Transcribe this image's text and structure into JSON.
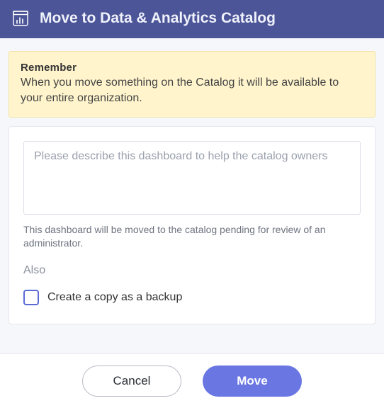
{
  "header": {
    "title": "Move to Data & Analytics Catalog"
  },
  "remember": {
    "title": "Remember",
    "text": "When you move something on the Catalog it will be available to your entire organization."
  },
  "form": {
    "description_placeholder": "Please describe this dashboard to help the catalog owners",
    "description_value": "",
    "pending_note": "This dashboard will be moved to the catalog pending for review of an administrator.",
    "also_label": "Also",
    "backup_checkbox": {
      "checked": false,
      "label": "Create a copy as a backup"
    }
  },
  "footer": {
    "cancel_label": "Cancel",
    "move_label": "Move"
  }
}
